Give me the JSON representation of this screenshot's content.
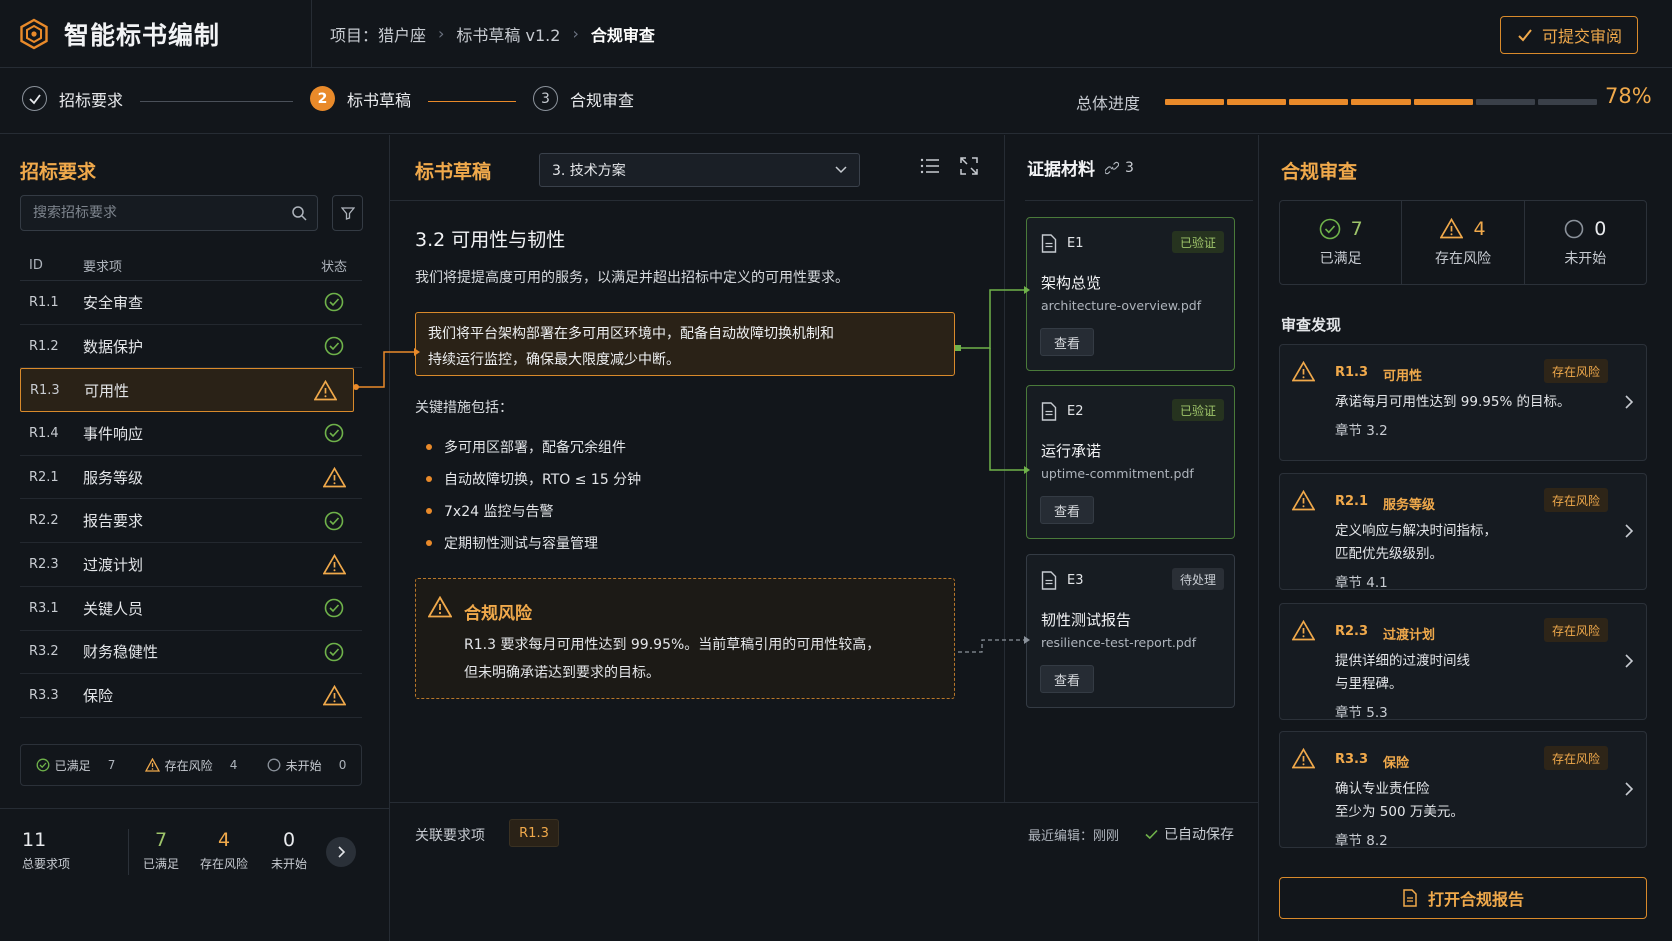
{
  "app": {
    "title": "智能标书编制",
    "submit_label": "可提交审阅"
  },
  "breadcrumb": {
    "project": "项目：猎户座",
    "draft": "标书草稿 v1.2",
    "current": "合规审查"
  },
  "steps": [
    {
      "label": "招标要求",
      "state": "done",
      "marker": ""
    },
    {
      "label": "标书草稿",
      "state": "active",
      "marker": "2"
    },
    {
      "label": "合规审查",
      "state": "pending",
      "marker": "3"
    }
  ],
  "progress": {
    "label": "总体进度",
    "value_text": "78%",
    "value": 0.78,
    "segments_total": 7,
    "segments_filled": 5
  },
  "requirements": {
    "title": "招标要求",
    "search_placeholder": "搜索招标要求",
    "columns": {
      "id": "ID",
      "name": "要求项",
      "status": "状态"
    },
    "rows": [
      {
        "id": "R1.1",
        "name": "安全审查",
        "status": "ok"
      },
      {
        "id": "R1.2",
        "name": "数据保护",
        "status": "ok"
      },
      {
        "id": "R1.3",
        "name": "可用性",
        "status": "risk"
      },
      {
        "id": "R1.4",
        "name": "事件响应",
        "status": "ok"
      },
      {
        "id": "R2.1",
        "name": "服务等级",
        "status": "risk"
      },
      {
        "id": "R2.2",
        "name": "报告要求",
        "status": "ok"
      },
      {
        "id": "R2.3",
        "name": "过渡计划",
        "status": "risk"
      },
      {
        "id": "R3.1",
        "name": "关键人员",
        "status": "ok"
      },
      {
        "id": "R3.2",
        "name": "财务稳健性",
        "status": "ok"
      },
      {
        "id": "R3.3",
        "name": "保险",
        "status": "risk"
      }
    ],
    "summary": {
      "ok_label": "已满足",
      "ok_count": "7",
      "risk_label": "存在风险",
      "risk_count": "4",
      "todo_label": "未开始",
      "todo_count": "0"
    },
    "footer": {
      "total": "11",
      "total_label": "总要求项",
      "ok": "7",
      "ok_label": "已满足",
      "risk": "4",
      "risk_label": "存在风险",
      "todo": "0",
      "todo_label": "未开始"
    }
  },
  "draft": {
    "title": "标书草稿",
    "section_selected": "3. 技术方案",
    "heading": "3.2 可用性与韧性",
    "intro": "我们将提提高度可用的服务，以满足并超出招标中定义的可用性要求。",
    "highlight_line1": "我们将平台架构部署在多可用区环境中，配备自动故障切换机制和",
    "highlight_line2": "持续运行监控，确保最大限度减少中断。",
    "measures_title": "关键措施包括：",
    "measures": [
      "多可用区部署，配备冗余组件",
      "自动故障切换，RTO ≤ 15 分钟",
      "7x24 监控与告警",
      "定期韧性测试与容量管理"
    ],
    "risk": {
      "title": "合规风险",
      "line1": "R1.3 要求每月可用性达到 99.95%。当前草稿引用的可用性较高，",
      "line2": "但未明确承诺达到要求的目标。"
    },
    "footer": {
      "linked_label": "关联要求项",
      "linked_tag": "R1.3",
      "edit_label": "最近编辑：刚刚",
      "autosave": "已自动保存"
    }
  },
  "evidence": {
    "title": "证据材料",
    "count": "3",
    "view_label": "查看",
    "items": [
      {
        "id": "E1",
        "badge": "已验证",
        "state": "verified",
        "name": "架构总览",
        "file": "architecture-overview.pdf"
      },
      {
        "id": "E2",
        "badge": "已验证",
        "state": "verified",
        "name": "运行承诺",
        "file": "uptime-commitment.pdf"
      },
      {
        "id": "E3",
        "badge": "待处理",
        "state": "pending",
        "name": "韧性测试报告",
        "file": "resilience-test-report.pdf"
      }
    ]
  },
  "review": {
    "title": "合规审查",
    "summary": {
      "ok": "7",
      "ok_label": "已满足",
      "risk": "4",
      "risk_label": "存在风险",
      "todo": "0",
      "todo_label": "未开始"
    },
    "findings_label": "审查发现",
    "findings": [
      {
        "id": "R1.3",
        "name": "可用性",
        "badge": "存在风险",
        "desc1": "承诺每月可用性达到 99.95% 的目标。",
        "desc2": "",
        "chapter": "章节 3.2"
      },
      {
        "id": "R2.1",
        "name": "服务等级",
        "badge": "存在风险",
        "desc1": "定义响应与解决时间指标，",
        "desc2": "匹配优先级级别。",
        "chapter": "章节 4.1"
      },
      {
        "id": "R2.3",
        "name": "过渡计划",
        "badge": "存在风险",
        "desc1": "提供详细的过渡时间线",
        "desc2": "与里程碑。",
        "chapter": "章节 5.3"
      },
      {
        "id": "R3.3",
        "name": "保险",
        "badge": "存在风险",
        "desc1": "确认专业责任险",
        "desc2": "至少为 500 万美元。",
        "chapter": "章节 8.2"
      }
    ],
    "report_button": "打开合规报告"
  },
  "colors": {
    "accent": "#e98a2a",
    "ok": "#6fb24a",
    "risk": "#f0a94b",
    "background": "#12161b"
  }
}
